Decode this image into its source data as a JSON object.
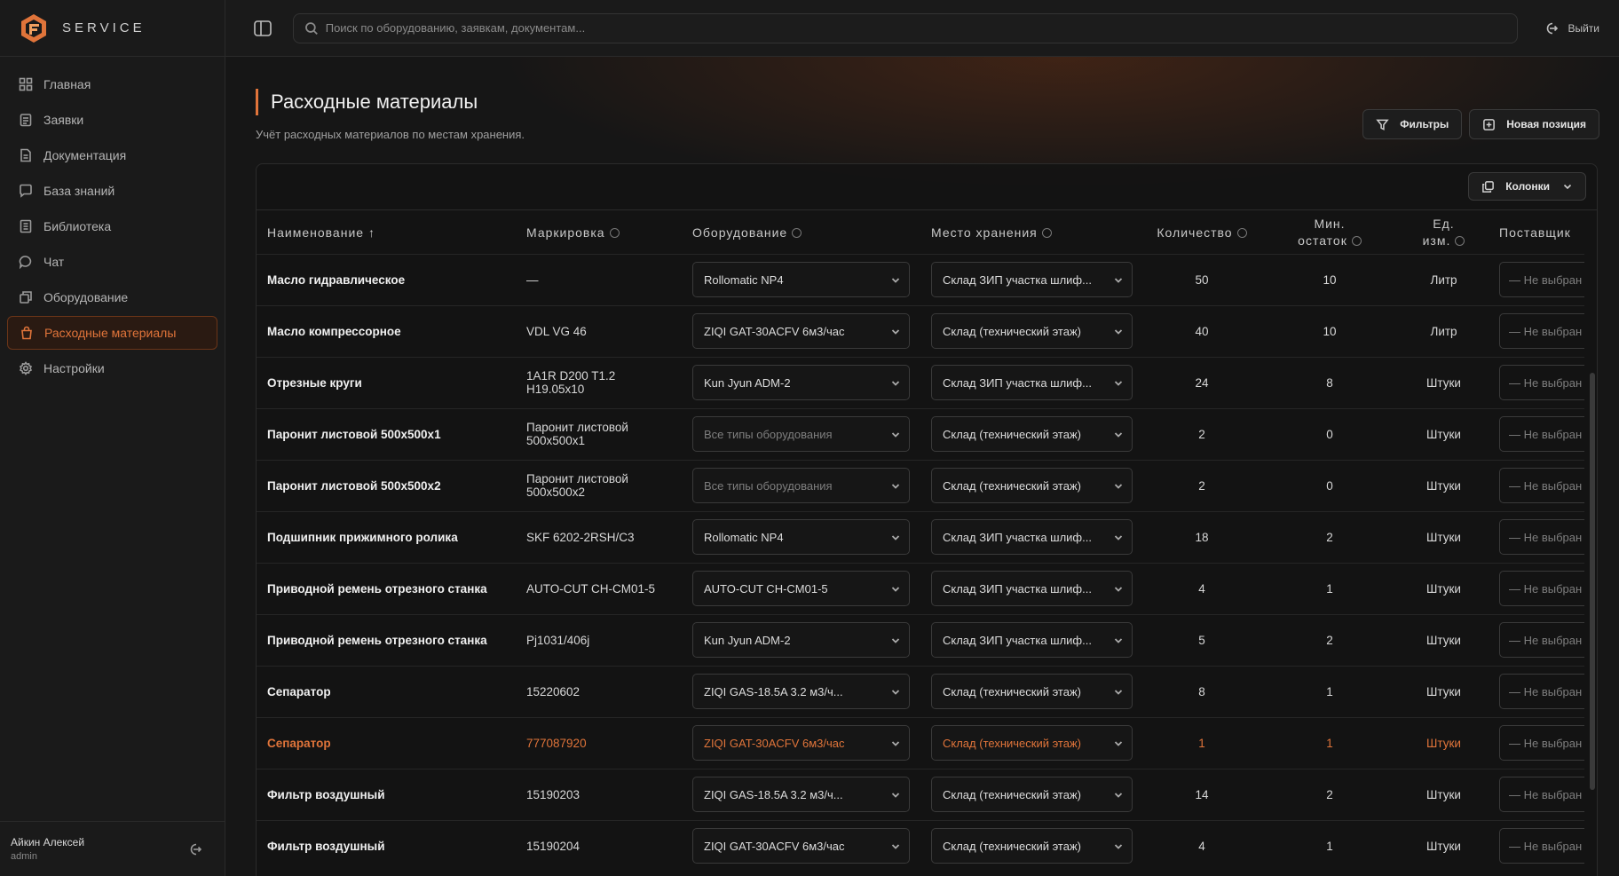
{
  "brand": {
    "name": "SERVICE"
  },
  "search": {
    "placeholder": "Поиск по оборудованию, заявкам, документам..."
  },
  "topbar": {
    "logout_label": "Выйти"
  },
  "sidebar": {
    "items": [
      {
        "label": "Главная",
        "icon": "grid-icon"
      },
      {
        "label": "Заявки",
        "icon": "clipboard-icon"
      },
      {
        "label": "Документация",
        "icon": "file-icon"
      },
      {
        "label": "База знаний",
        "icon": "message-square-icon"
      },
      {
        "label": "Библиотека",
        "icon": "book-icon"
      },
      {
        "label": "Чат",
        "icon": "chat-icon"
      },
      {
        "label": "Оборудование",
        "icon": "equipment-icon"
      },
      {
        "label": "Расходные материалы",
        "icon": "bag-icon",
        "active": true
      },
      {
        "label": "Настройки",
        "icon": "gear-icon"
      }
    ]
  },
  "user": {
    "name": "Айкин Алексей",
    "role": "admin"
  },
  "page": {
    "title": "Расходные материалы",
    "subtitle": "Учёт расходных материалов по местам хранения.",
    "filters_label": "Фильтры",
    "new_label": "Новая позиция",
    "columns_label": "Колонки"
  },
  "table": {
    "headers": {
      "name": "Наименование ↑",
      "marking": "Маркировка",
      "equipment": "Оборудование",
      "storage": "Место хранения",
      "qty": "Количество",
      "min_line1": "Мин.",
      "min_line2": "остаток",
      "unit_line1": "Ед.",
      "unit_line2": "изм.",
      "supplier": "Поставщик"
    },
    "supplier_placeholder": "— Не выбран",
    "rows": [
      {
        "name": "Масло гидравлическое",
        "marking": "—",
        "equipment": "Rollomatic NP4",
        "storage": "Склад ЗИП участка шлиф...",
        "qty": "50",
        "min": "10",
        "unit": "Литр"
      },
      {
        "name": "Масло компрессорное",
        "marking": "VDL VG 46",
        "equipment": "ZIQI GAT-30ACFV 6м3/час",
        "storage": "Склад (технический этаж)",
        "qty": "40",
        "min": "10",
        "unit": "Литр"
      },
      {
        "name": "Отрезные круги",
        "marking": "1A1R D200 T1.2 H19.05x10",
        "equipment": "Kun Jyun ADM-2",
        "storage": "Склад ЗИП участка шлиф...",
        "qty": "24",
        "min": "8",
        "unit": "Штуки"
      },
      {
        "name": "Паронит листовой 500х500х1",
        "marking": "Паронит листовой 500х500х1",
        "equipment": "Все типы оборудования",
        "equipment_placeholder": true,
        "storage": "Склад (технический этаж)",
        "qty": "2",
        "min": "0",
        "unit": "Штуки"
      },
      {
        "name": "Паронит листовой 500х500х2",
        "marking": "Паронит листовой 500х500х2",
        "equipment": "Все типы оборудования",
        "equipment_placeholder": true,
        "storage": "Склад (технический этаж)",
        "qty": "2",
        "min": "0",
        "unit": "Штуки"
      },
      {
        "name": "Подшипник прижимного ролика",
        "marking": "SKF 6202-2RSH/C3",
        "equipment": "Rollomatic NP4",
        "storage": "Склад ЗИП участка шлиф...",
        "qty": "18",
        "min": "2",
        "unit": "Штуки"
      },
      {
        "name": "Приводной ремень отрезного станка",
        "marking": "AUTO-CUT CH-CM01-5",
        "equipment": "AUTO-CUT CH-CM01-5",
        "storage": "Склад ЗИП участка шлиф...",
        "qty": "4",
        "min": "1",
        "unit": "Штуки"
      },
      {
        "name": "Приводной ремень отрезного станка",
        "marking": "Pj1031/406j",
        "equipment": "Kun Jyun ADM-2",
        "storage": "Склад ЗИП участка шлиф...",
        "qty": "5",
        "min": "2",
        "unit": "Штуки"
      },
      {
        "name": "Сепаратор",
        "marking": "15220602",
        "equipment": "ZIQI GAS-18.5A 3.2 м3/ч...",
        "storage": "Склад (технический этаж)",
        "qty": "8",
        "min": "1",
        "unit": "Штуки"
      },
      {
        "name": "Сепаратор",
        "marking": "777087920",
        "equipment": "ZIQI GAT-30ACFV 6м3/час",
        "storage": "Склад (технический этаж)",
        "qty": "1",
        "min": "1",
        "unit": "Штуки",
        "low_stock": true
      },
      {
        "name": "Фильтр воздушный",
        "marking": "15190203",
        "equipment": "ZIQI GAS-18.5A 3.2 м3/ч...",
        "storage": "Склад (технический этаж)",
        "qty": "14",
        "min": "2",
        "unit": "Штуки"
      },
      {
        "name": "Фильтр воздушный",
        "marking": "15190204",
        "equipment": "ZIQI GAT-30ACFV 6м3/час",
        "storage": "Склад (технический этаж)",
        "qty": "4",
        "min": "1",
        "unit": "Штуки"
      }
    ]
  },
  "colors": {
    "accent": "#e0743a",
    "background": "#161616",
    "panel": "#1a1a1a"
  }
}
